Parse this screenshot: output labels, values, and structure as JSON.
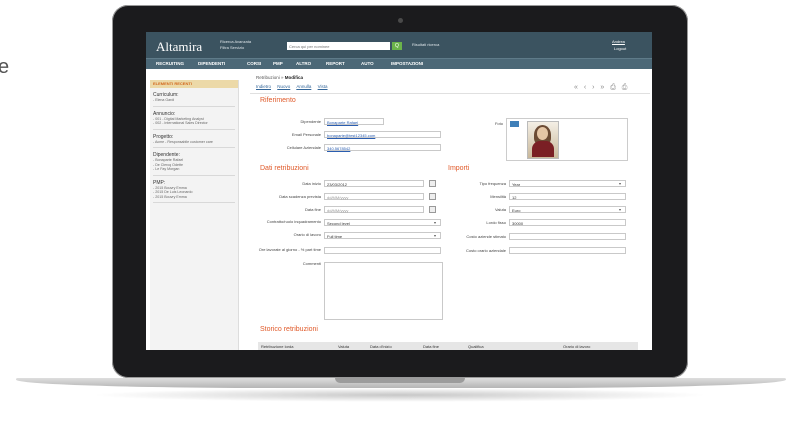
{
  "side_text": "e",
  "header": {
    "logo": "Altamira",
    "ricerca_1": "Ricerca Avanzata",
    "ricerca_2": "Filtra Servizio",
    "search_placeholder": "Cerca qui per nominee",
    "search_button": "Q",
    "advanced": "Risultati ricerca",
    "user": "Andrea",
    "logout": "Logout"
  },
  "nav": [
    "RECRUITING",
    "DIPENDENTI",
    "CORSI",
    "PMP",
    "ALTRO",
    "REPORT",
    "AUTO",
    "IMPOSTAZIONI"
  ],
  "sidebar": {
    "title": "ELEMENTI RECENTI",
    "sections": [
      {
        "title": "Curriculum:",
        "items": [
          "- Elena Gardi"
        ]
      },
      {
        "title": "Annuncio:",
        "items": [
          "- 001 - Digital Marketing Analyst",
          "- 002 - International Sales Director"
        ]
      },
      {
        "title": "Progetto:",
        "items": [
          "- Acme - Responsabile customer care"
        ]
      },
      {
        "title": "Dipendente:",
        "items": [
          "- Bonaparte Rafael",
          "- De Clercq Odette",
          "- Le Fay Morgan"
        ]
      },
      {
        "title": "PMP:",
        "items": [
          "- 2015 Bouvry Emma",
          "- 2015 De Luis Leonardo",
          "- 2015 Bouvry Emma"
        ]
      }
    ]
  },
  "main": {
    "crumb_parent": "Retribuzioni »",
    "crumb_current": "Modifica",
    "toolbar": [
      "Indietro",
      "Nuovo",
      "Annulla",
      "Vista"
    ],
    "pager": "« ‹ › » ⎙ ⎙",
    "section_1": "Riferimento",
    "dipendente_label": "Dipendente",
    "dipendente_value": "Bonaparte Rafael",
    "email_label": "Email Personale",
    "email_value": "bonaparte@test12345.com",
    "cell_label": "Cellulare Aziendale",
    "cell_value": "340.5678542",
    "foto_label": "Foto",
    "section_2": "Dati retribuzioni",
    "data_inizio_label": "Data inizio",
    "data_inizio_value": "23/03/2012",
    "scad_label": "Data scadenza prevista",
    "scad_value": "dd/MM/yyyy",
    "fine_label": "Data fine",
    "fine_value": "dd/MM/yyyy",
    "contratto_label": "Contratto/ruolo inquadramento",
    "contratto_value": "Second level",
    "orario_label": "Orario di lavoro",
    "orario_value": "Full time",
    "ore_label": "Ore lavorate al giorno - % part time",
    "commenti_label": "Commenti",
    "section_3": "Importi",
    "tipo_label": "Tipo frequenza",
    "tipo_value": "Year",
    "mensilita_label": "Mensilità",
    "mensilita_value": "12",
    "valuta_label": "Valuta",
    "valuta_value": "Euro",
    "lordo_label": "Lordo fisso",
    "lordo_value": "30000",
    "costo1_label": "Costo aziende stimato",
    "costo2_label": "Costo orario aziendale",
    "section_4": "Storico retribuzioni",
    "table_headers": [
      "Retribuzione lorda",
      "Valuta",
      "Data d'inizio",
      "Data fine",
      "Qualifica",
      "Orario di lavoro"
    ]
  }
}
